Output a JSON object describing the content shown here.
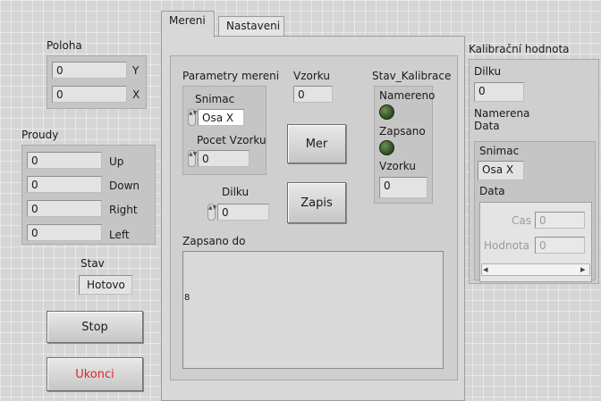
{
  "position": {
    "title": "Poloha",
    "fields": [
      {
        "axis": "Y",
        "value": "0"
      },
      {
        "axis": "X",
        "value": "0"
      }
    ]
  },
  "currents": {
    "title": "Proudy",
    "fields": [
      {
        "label": "Up",
        "value": "0"
      },
      {
        "label": "Down",
        "value": "0"
      },
      {
        "label": "Right",
        "value": "0"
      },
      {
        "label": "Left",
        "value": "0"
      }
    ]
  },
  "status": {
    "label": "Stav",
    "value": "Hotovo"
  },
  "buttons": {
    "stop": "Stop",
    "quit": "Ukonci",
    "measure": "Mer",
    "write": "Zapis"
  },
  "quit_color": "#e0262b",
  "tabs": [
    {
      "label": "Mereni",
      "active": true
    },
    {
      "label": "Nastaveni",
      "active": false
    }
  ],
  "mereni": {
    "params_title": "Parametry mereni",
    "sensor_label": "Snimac",
    "sensor_value": "Osa X",
    "sample_count_label": "Pocet Vzorku",
    "sample_count_value": "0",
    "samples_label": "Vzorku",
    "samples_value": "0",
    "calib_title": "Stav_Kalibrace",
    "measured_label": "Namereno",
    "written_label": "Zapsano",
    "calib_samples_label": "Vzorku",
    "calib_samples_value": "0",
    "divisions_label": "Dilku",
    "divisions_value": "0",
    "written_to_label": "Zapsano do",
    "written_to_marker": "8"
  },
  "calibration": {
    "title": "Kalibrační hodnota",
    "divisions_label": "Dilku",
    "divisions_value": "0",
    "measured_data_label": "Namerena\nData",
    "sensor_label": "Snimac",
    "sensor_value": "Osa X",
    "data_label": "Data",
    "time_label": "Cas",
    "time_value": "0",
    "value_label": "Hodnota",
    "value_value": "0",
    "scroll_left": "◂",
    "scroll_right": "▸"
  },
  "led_color": "#3b5e2a"
}
